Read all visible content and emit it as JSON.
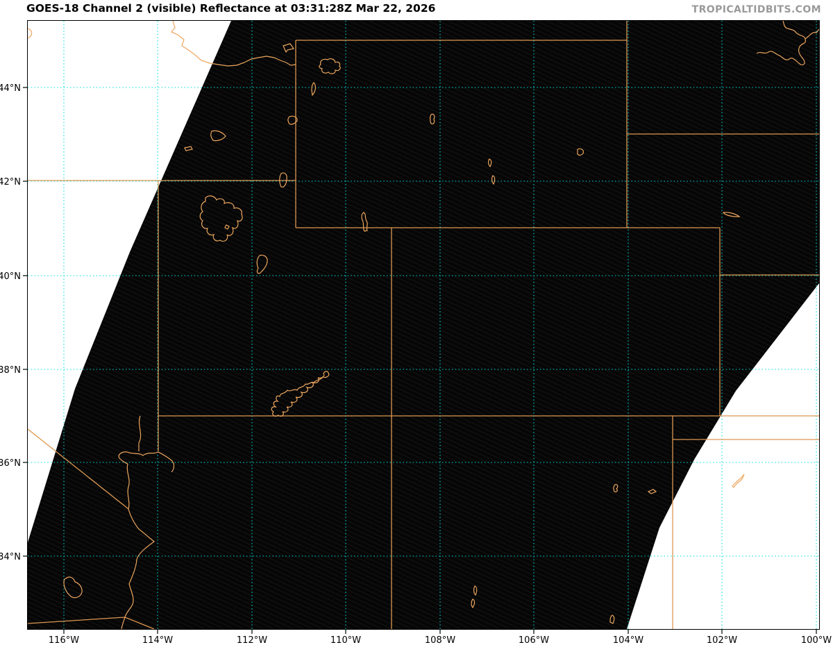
{
  "header": {
    "title": "GOES-18 Channel 2 (visible) Reflectance at 03:31:28Z Mar 22, 2026",
    "watermark": "TROPICALTIDBITS.COM"
  },
  "map_info": {
    "satellite": "GOES-18",
    "channel": "Channel 2 (visible)",
    "product": "Reflectance",
    "valid_time": "03:31:28Z Mar 22, 2026"
  },
  "axes": {
    "lat_labels": [
      "44°N",
      "42°N",
      "40°N",
      "38°N",
      "36°N",
      "34°N"
    ],
    "lon_labels": [
      "116°W",
      "114°W",
      "112°W",
      "110°W",
      "108°W",
      "106°W",
      "104°W",
      "102°W",
      "100°W"
    ]
  },
  "colors": {
    "graticule_cyan": "#00dcdc",
    "state_border_orange": "#dd9851",
    "water_feature_orange": "#eda65e",
    "swath_night_black": "#070707",
    "no_data_white": "#ffffff",
    "title_text": "#000000",
    "watermark_text": "#9a9a9a"
  }
}
